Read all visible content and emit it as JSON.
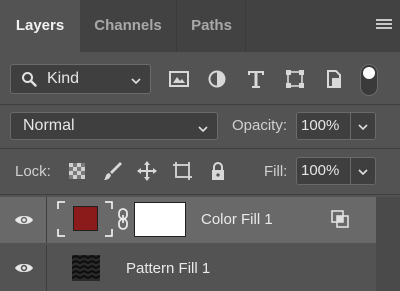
{
  "tabs": [
    {
      "label": "Layers",
      "active": true
    },
    {
      "label": "Channels",
      "active": false
    },
    {
      "label": "Paths",
      "active": false
    }
  ],
  "filter": {
    "kind_label": "Kind",
    "icons": [
      "image-filter-icon",
      "adjustment-filter-icon",
      "type-filter-icon",
      "shape-filter-icon",
      "smart-object-filter-icon"
    ]
  },
  "blend": {
    "mode": "Normal",
    "opacity_label": "Opacity:",
    "opacity_value": "100%"
  },
  "lock": {
    "label": "Lock:",
    "icons": [
      "lock-transparent-pixels-icon",
      "lock-image-pixels-icon",
      "lock-position-icon",
      "lock-artboard-icon",
      "lock-all-icon"
    ],
    "fill_label": "Fill:",
    "fill_value": "100%"
  },
  "layers": [
    {
      "name": "Color Fill 1",
      "selected": true,
      "fill_color": "#8b1a1a"
    },
    {
      "name": "Pattern Fill 1",
      "selected": false
    }
  ],
  "colors": {
    "panel_bg": "#535353",
    "tabbar_bg": "#424242",
    "selected_layer_bg": "#696969",
    "field_bg": "#3f3f3f"
  }
}
